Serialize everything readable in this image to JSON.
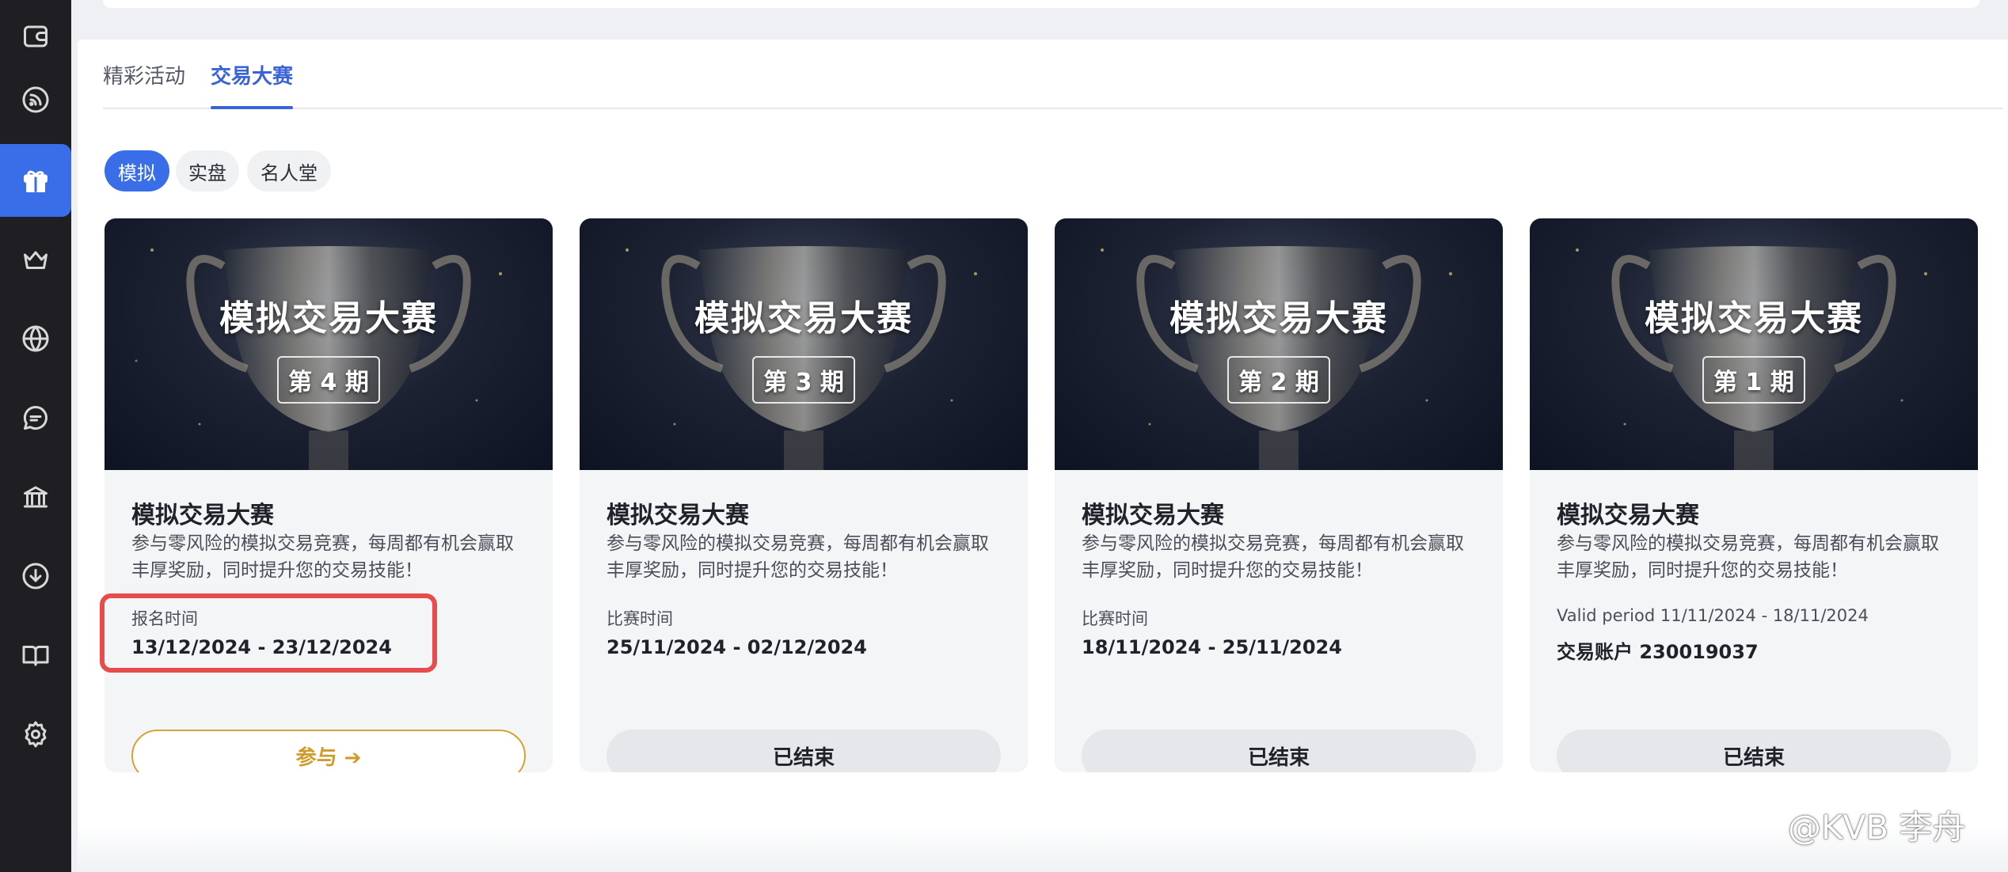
{
  "sidebar": {
    "items": [
      {
        "icon": "wallet-icon"
      },
      {
        "icon": "rss-icon"
      },
      {
        "icon": "gift-icon",
        "active": true
      },
      {
        "icon": "crown-icon"
      },
      {
        "icon": "globe-icon"
      },
      {
        "icon": "chat-icon"
      },
      {
        "icon": "bank-icon"
      },
      {
        "icon": "download-icon"
      },
      {
        "icon": "book-icon"
      },
      {
        "icon": "gear-icon"
      }
    ]
  },
  "tabs": [
    {
      "label": "精彩活动",
      "active": false
    },
    {
      "label": "交易大赛",
      "active": true
    }
  ],
  "filters": [
    {
      "label": "模拟",
      "active": true
    },
    {
      "label": "实盘",
      "active": false
    },
    {
      "label": "名人堂",
      "active": false
    }
  ],
  "cards": [
    {
      "banner_title": "模拟交易大赛",
      "banner_issue": "第 4 期",
      "title": "模拟交易大赛",
      "description": "参与零风险的模拟交易竞赛，每周都有机会赢取丰厚奖励，同时提升您的交易技能！",
      "period_label": "报名时间",
      "period_value": "13/12/2024 - 23/12/2024",
      "button_label": "参与 ➔",
      "button_state": "join"
    },
    {
      "banner_title": "模拟交易大赛",
      "banner_issue": "第 3 期",
      "title": "模拟交易大赛",
      "description": "参与零风险的模拟交易竞赛，每周都有机会赢取丰厚奖励，同时提升您的交易技能！",
      "period_label": "比赛时间",
      "period_value": "25/11/2024 - 02/12/2024",
      "button_label": "已结束",
      "button_state": "ended"
    },
    {
      "banner_title": "模拟交易大赛",
      "banner_issue": "第 2 期",
      "title": "模拟交易大赛",
      "description": "参与零风险的模拟交易竞赛，每周都有机会赢取丰厚奖励，同时提升您的交易技能！",
      "period_label": "比赛时间",
      "period_value": "18/11/2024 - 25/11/2024",
      "button_label": "已结束",
      "button_state": "ended"
    },
    {
      "banner_title": "模拟交易大赛",
      "banner_issue": "第 1 期",
      "title": "模拟交易大赛",
      "description": "参与零风险的模拟交易竞赛，每周都有机会赢取丰厚奖励，同时提升您的交易技能！",
      "period_label": "Valid period 11/11/2024 - 18/11/2024",
      "period_value": "交易账户 230019037",
      "button_label": "已结束",
      "button_state": "ended"
    }
  ],
  "colors": {
    "accent": "#3a6ee8",
    "join_button": "#d7a236",
    "highlight_box": "#e84b4b",
    "sidebar_bg": "#1f1f23"
  },
  "watermark": "@KVB 李舟"
}
